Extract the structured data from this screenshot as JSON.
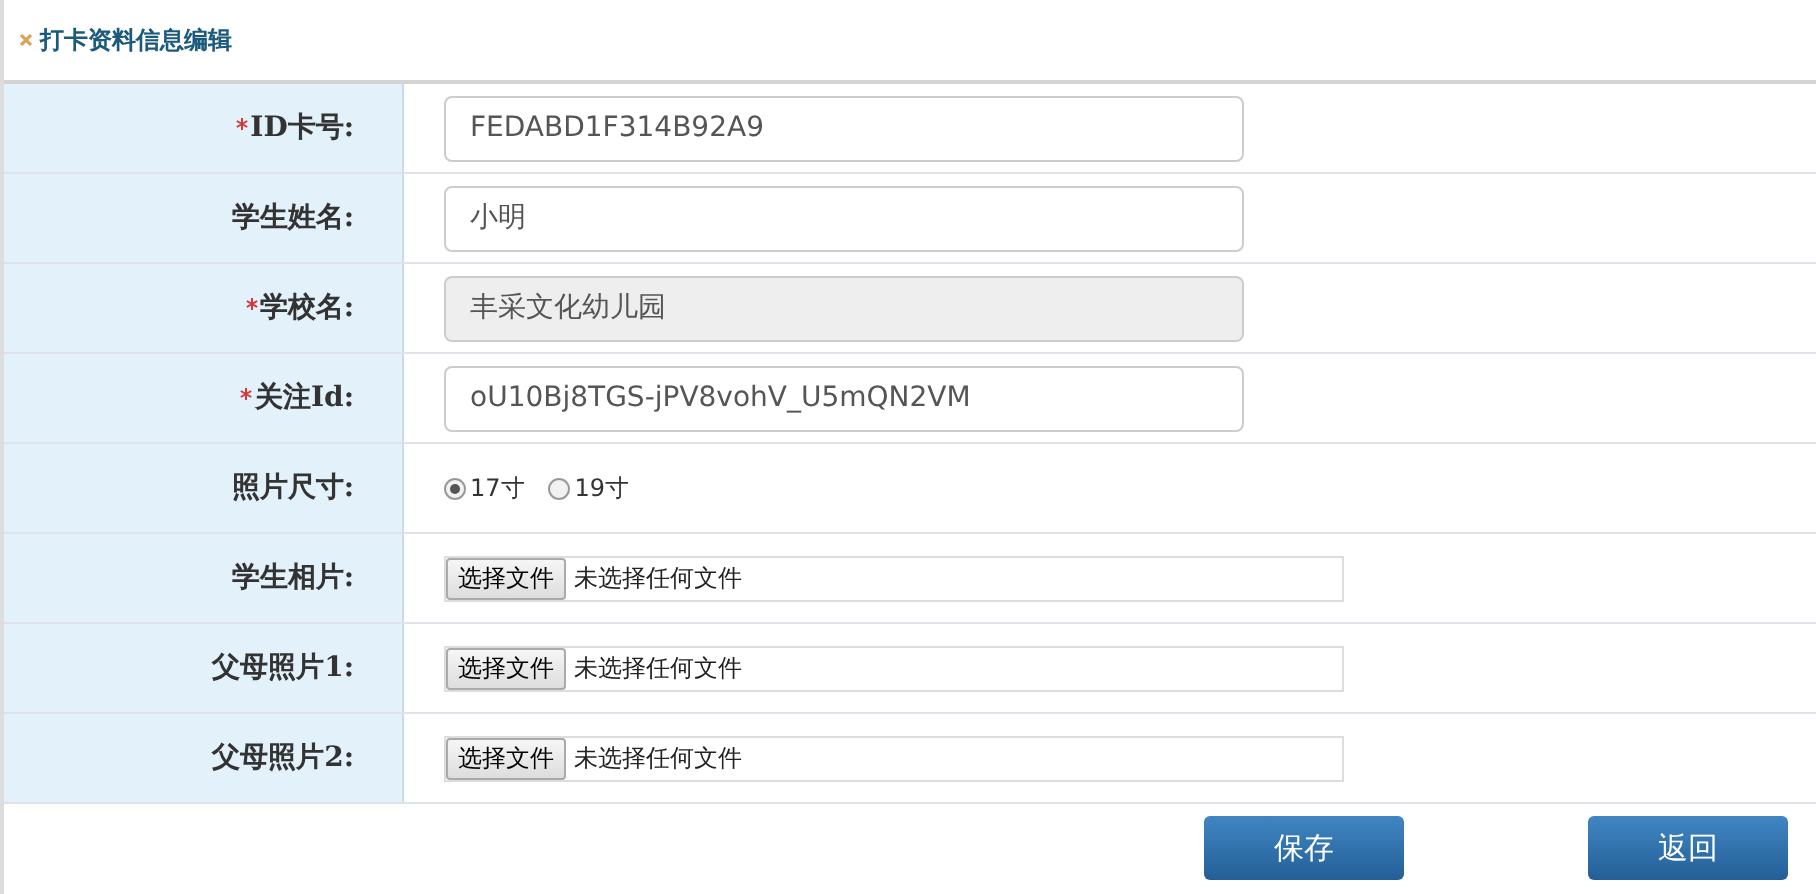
{
  "header": {
    "title": "打卡资料信息编辑"
  },
  "rows": [
    {
      "kind": "text",
      "label": "ID卡号:",
      "required": true,
      "value": "FEDABD1F314B92A9",
      "disabled": false
    },
    {
      "kind": "text",
      "label": "学生姓名:",
      "required": false,
      "value": "小明",
      "disabled": false
    },
    {
      "kind": "text",
      "label": "学校名:",
      "required": true,
      "value": "丰采文化幼儿园",
      "disabled": true
    },
    {
      "kind": "text",
      "label": "关注Id:",
      "required": true,
      "value": "oU10Bj8TGS-jPV8vohV_U5mQN2VM",
      "disabled": false
    },
    {
      "kind": "radio",
      "label": "照片尺寸:",
      "required": false,
      "options": [
        {
          "label": "17寸",
          "selected": true
        },
        {
          "label": "19寸",
          "selected": false
        }
      ]
    },
    {
      "kind": "file",
      "label": "学生相片:",
      "required": false,
      "button": "选择文件",
      "status": "未选择任何文件"
    },
    {
      "kind": "file",
      "label": "父母照片1:",
      "required": false,
      "button": "选择文件",
      "status": "未选择任何文件"
    },
    {
      "kind": "file",
      "label": "父母照片2:",
      "required": false,
      "button": "选择文件",
      "status": "未选择任何文件"
    }
  ],
  "buttons": [
    "保存",
    "返回"
  ]
}
